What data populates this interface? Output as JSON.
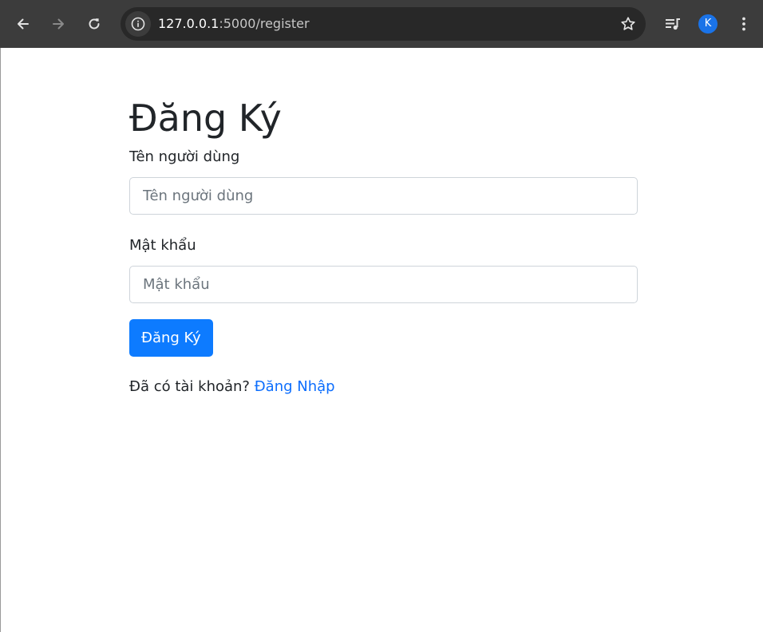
{
  "browser": {
    "url_host": "127.0.0.1",
    "url_rest": ":5000/register",
    "profile_initial": "K",
    "icons": [
      "back-icon",
      "forward-icon",
      "reload-icon",
      "site-info-icon",
      "bookmark-star-icon",
      "media-queue-icon",
      "profile-avatar",
      "more-menu-icon"
    ]
  },
  "page": {
    "title": "Đăng Ký",
    "username_label": "Tên người dùng",
    "username_placeholder": "Tên người dùng",
    "username_value": "",
    "password_label": "Mật khẩu",
    "password_placeholder": "Mật khẩu",
    "password_value": "",
    "submit_label": "Đăng Ký",
    "login_prompt": "Đã có tài khoản?",
    "login_link": "Đăng Nhập"
  },
  "colors": {
    "toolbar": "#3c3c3c",
    "omnibox": "#282828",
    "primary": "#0d7bff",
    "link": "#0d6efd",
    "text": "#212529"
  }
}
